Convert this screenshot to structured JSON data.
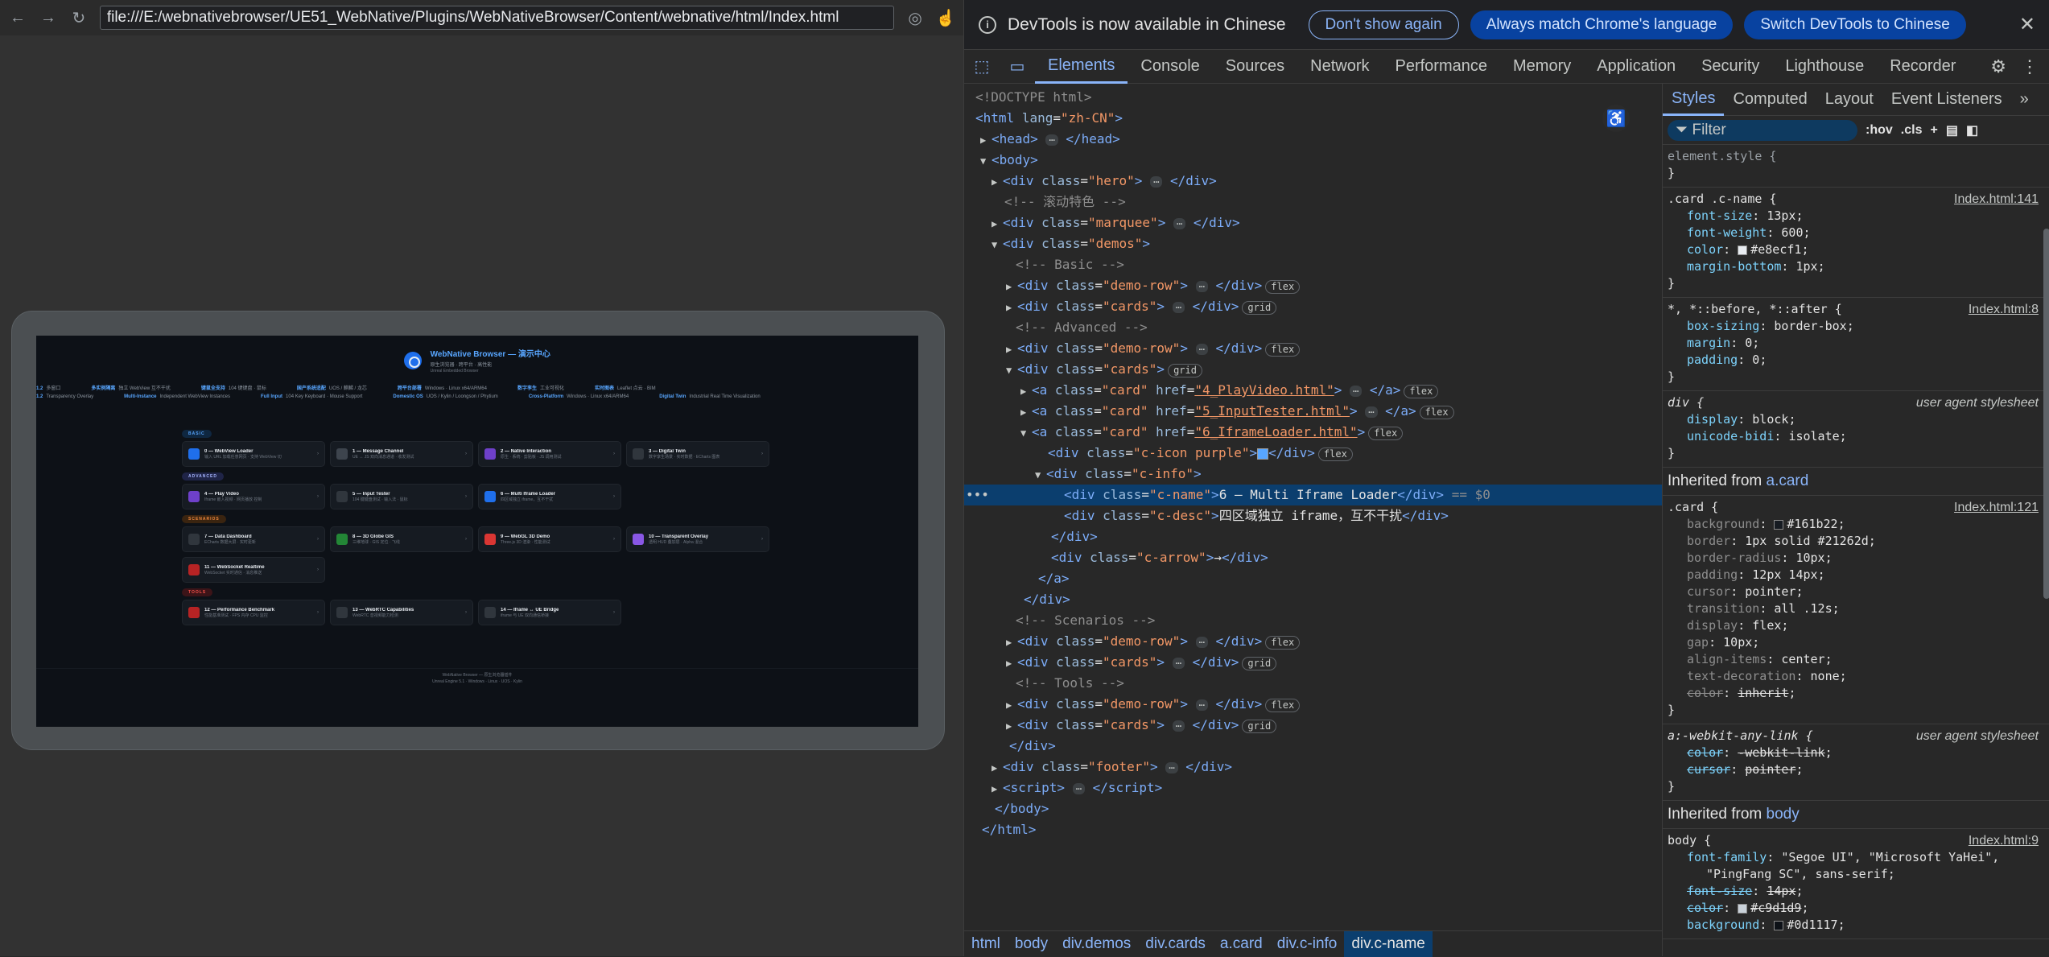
{
  "browser": {
    "url": "file:///E:/webnativebrowser/UE51_WebNative/Plugins/WebNativeBrowser/Content/webnative/html/Index.html"
  },
  "preview": {
    "title": "WebNative Browser — 演示中心",
    "subtitle": "原生浏览器 · 跨平台 · 高性能",
    "tagline": "Unreal Embedded Browser",
    "marquee_row1": [
      {
        "k": "1.2",
        "v": "多窗口"
      },
      {
        "k": "多实例隔离",
        "v": "独立 WebView 互不干扰"
      },
      {
        "k": "键鼠全支持",
        "v": "104 键键盘 · 鼠标"
      },
      {
        "k": "国产系统适配",
        "v": "UOS / 麒麟 / 龙芯"
      },
      {
        "k": "跨平台部署",
        "v": "Windows · Linux x64/ARM64"
      },
      {
        "k": "数字孪生",
        "v": "工业可视化"
      },
      {
        "k": "实时图表",
        "v": "Leaflet 点云 · BIM"
      }
    ],
    "marquee_row2": [
      {
        "k": "1.2",
        "v": "Transparency Overlay"
      },
      {
        "k": "Multi-Instance",
        "v": "Independent WebView Instances"
      },
      {
        "k": "Full Input",
        "v": "104 Key Keyboard · Mouse Support"
      },
      {
        "k": "Domestic OS",
        "v": "UOS / Kylin / Loongson / Phytium"
      },
      {
        "k": "Cross-Platform",
        "v": "Windows · Linux x64/ARM64"
      },
      {
        "k": "Digital Twin",
        "v": "Industrial Real Time Visualization"
      }
    ],
    "sections": [
      {
        "badge": "BASIC",
        "cls": "b-basic",
        "cards": [
          {
            "name": "0 — WebView Loader",
            "desc": "输入 URL 加载任意网页 · 支持 WebView 切",
            "color": "#1f6feb"
          },
          {
            "name": "1 — Message Channel",
            "desc": "UE ↔ JS 双向消息通道 · 收发测试",
            "color": "#3d444d"
          },
          {
            "name": "2 — Native Interaction",
            "desc": "原生 · 系统 · 剪贴板 · JS 调用测试",
            "color": "#6e40c9"
          },
          {
            "name": "3 — Digital Twin",
            "desc": "数字孪生场景 · 实时数据 · ECharts 图表",
            "color": "#30363d"
          }
        ]
      },
      {
        "badge": "ADVANCED",
        "cls": "b-adv",
        "cards": [
          {
            "name": "4 — Play Video",
            "desc": "Iframe 嵌入视频 · 网页播放 控制",
            "color": "#6e40c9"
          },
          {
            "name": "5 — Input Tester",
            "desc": "104 键键盘测试 · 输入法 · 鼠标",
            "color": "#30363d"
          },
          {
            "name": "6 — Multi Iframe Loader",
            "desc": "四区域独立 iframe，互不干扰",
            "color": "#1f6feb"
          }
        ]
      },
      {
        "badge": "SCENARIOS",
        "cls": "b-scn",
        "cards": [
          {
            "name": "7 — Data Dashboard",
            "desc": "ECharts 数据大屏 · 实时更新",
            "color": "#30363d"
          },
          {
            "name": "8 — 3D Globe GIS",
            "desc": "三维地球 · GIS 定位 · 飞线",
            "color": "#238636"
          },
          {
            "name": "9 — WebGL 3D Demo",
            "desc": "Three.js 3D 渲染 · 性能测试",
            "color": "#da3633"
          },
          {
            "name": "10 — Transparent Overlay",
            "desc": "透明 HUD 叠加层 · Alpha 混合",
            "color": "#8957e5"
          },
          {
            "name": "11 — WebSocket Realtime",
            "desc": "WebSocket 实时通信 · 消息推送",
            "color": "#b62324"
          }
        ]
      },
      {
        "badge": "TOOLS",
        "cls": "b-tool",
        "cards": [
          {
            "name": "12 — Performance Benchmark",
            "desc": "性能基准测试 · FPS 内存 CPU 监控",
            "color": "#b62324"
          },
          {
            "name": "13 — WebRTC Capabilities",
            "desc": "WebRTC 音视频能力检测",
            "color": "#30363d"
          },
          {
            "name": "14 — Iframe ↔ UE Bridge",
            "desc": "iframe 与 UE 双向通信桥接",
            "color": "#30363d"
          }
        ]
      }
    ],
    "footer_line1": "WebNative Browser — 原生浏览器插件",
    "footer_line2": "Unreal Engine 5.1 · Windows · Linux · UOS · Kylin"
  },
  "devtools": {
    "banner": {
      "message": "DevTools is now available in Chinese",
      "btn_dont_show": "Don't show again",
      "btn_match": "Always match Chrome's language",
      "btn_switch": "Switch DevTools to Chinese"
    },
    "tabs": [
      "Elements",
      "Console",
      "Sources",
      "Network",
      "Performance",
      "Memory",
      "Application",
      "Security",
      "Lighthouse",
      "Recorder"
    ],
    "breadcrumbs": [
      "html",
      "body",
      "div.demos",
      "div.cards",
      "a.card",
      "div.c-info",
      "div.c-name"
    ],
    "style_tabs": [
      "Styles",
      "Computed",
      "Layout",
      "Event Listeners"
    ],
    "filter_placeholder": "Filter",
    "hov": ":hov",
    "cls": ".cls"
  },
  "dom_text": {
    "doctype": "<!DOCTYPE html>",
    "c_marquee": "<!-- 滚动特色 -->",
    "c_basic": "<!-- Basic -->",
    "c_adv": "<!-- Advanced -->",
    "c_scn": "<!-- Scenarios -->",
    "c_tools": "<!-- Tools -->",
    "selected_text": "6 — Multi Iframe Loader",
    "desc_text": "四区域独立 iframe，互不干扰",
    "arrow_text": "→",
    "dollar": "== $0"
  },
  "styles": {
    "element_style": "element.style {",
    "rule1_selector": ".card .c-name {",
    "rule1_src": "Index.html:141",
    "rule1_props": [
      [
        "font-size",
        "13px"
      ],
      [
        "font-weight",
        "600"
      ],
      [
        "color",
        "#e8ecf1"
      ],
      [
        "margin-bottom",
        "1px"
      ]
    ],
    "rule2_selector": "*, *::before, *::after {",
    "rule2_src": "Index.html:8",
    "rule2_props": [
      [
        "box-sizing",
        "border-box"
      ],
      [
        "margin",
        "0"
      ],
      [
        "padding",
        "0"
      ]
    ],
    "rule3_selector": "div {",
    "rule3_src": "user agent stylesheet",
    "rule3_props": [
      [
        "display",
        "block"
      ],
      [
        "unicode-bidi",
        "isolate"
      ]
    ],
    "inh1_label": "Inherited from",
    "inh1_target": "a.card",
    "rule4_selector": ".card {",
    "rule4_src": "Index.html:121",
    "rule4_props": [
      [
        "background",
        "#161b22"
      ],
      [
        "border",
        "1px solid #21262d"
      ],
      [
        "border-radius",
        "10px"
      ],
      [
        "padding",
        "12px 14px"
      ],
      [
        "cursor",
        "pointer"
      ],
      [
        "transition",
        "all .12s"
      ],
      [
        "display",
        "flex"
      ],
      [
        "gap",
        "10px"
      ],
      [
        "align-items",
        "center"
      ],
      [
        "text-decoration",
        "none"
      ],
      [
        "color",
        "inherit"
      ]
    ],
    "rule5_selector": "a:-webkit-any-link {",
    "rule5_src": "user agent stylesheet",
    "rule5_props": [
      [
        "color",
        "-webkit-link"
      ],
      [
        "cursor",
        "pointer"
      ]
    ],
    "inh2_label": "Inherited from",
    "inh2_target": "body",
    "rule6_selector": "body {",
    "rule6_src": "Index.html:9",
    "rule6_font": "\"Segoe UI\", \"Microsoft YaHei\",",
    "rule6_font2": "\"PingFang SC\", sans-serif;",
    "rule6_props": [
      [
        "font-size",
        "14px"
      ],
      [
        "color",
        "#c9d1d9"
      ],
      [
        "background",
        "#0d1117"
      ]
    ]
  }
}
